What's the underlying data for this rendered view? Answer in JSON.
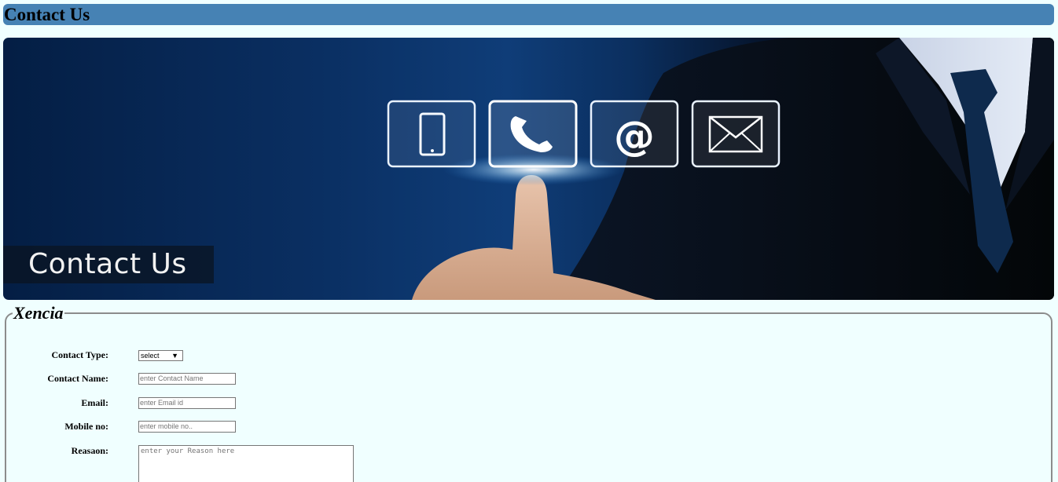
{
  "header": {
    "title": "Contact Us"
  },
  "banner": {
    "caption": "Contact Us",
    "icons": [
      "mobile-phone-icon",
      "telephone-icon",
      "at-sign-icon",
      "envelope-icon"
    ],
    "at_glyph": "@"
  },
  "form": {
    "legend": "Xencia",
    "contact_type": {
      "label": "Contact Type:",
      "selected": "select",
      "arrow": "▼"
    },
    "contact_name": {
      "label": "Contact Name:",
      "placeholder": "enter Contact Name"
    },
    "email": {
      "label": "Email:",
      "placeholder": "enter Email id"
    },
    "mobile": {
      "label": "Mobile no:",
      "placeholder": "enter mobile no.."
    },
    "reason": {
      "label": "Reasaon:",
      "placeholder": "enter your Reason here"
    }
  },
  "colors": {
    "header_bg": "#4682b4",
    "page_bg": "#f0ffff"
  }
}
